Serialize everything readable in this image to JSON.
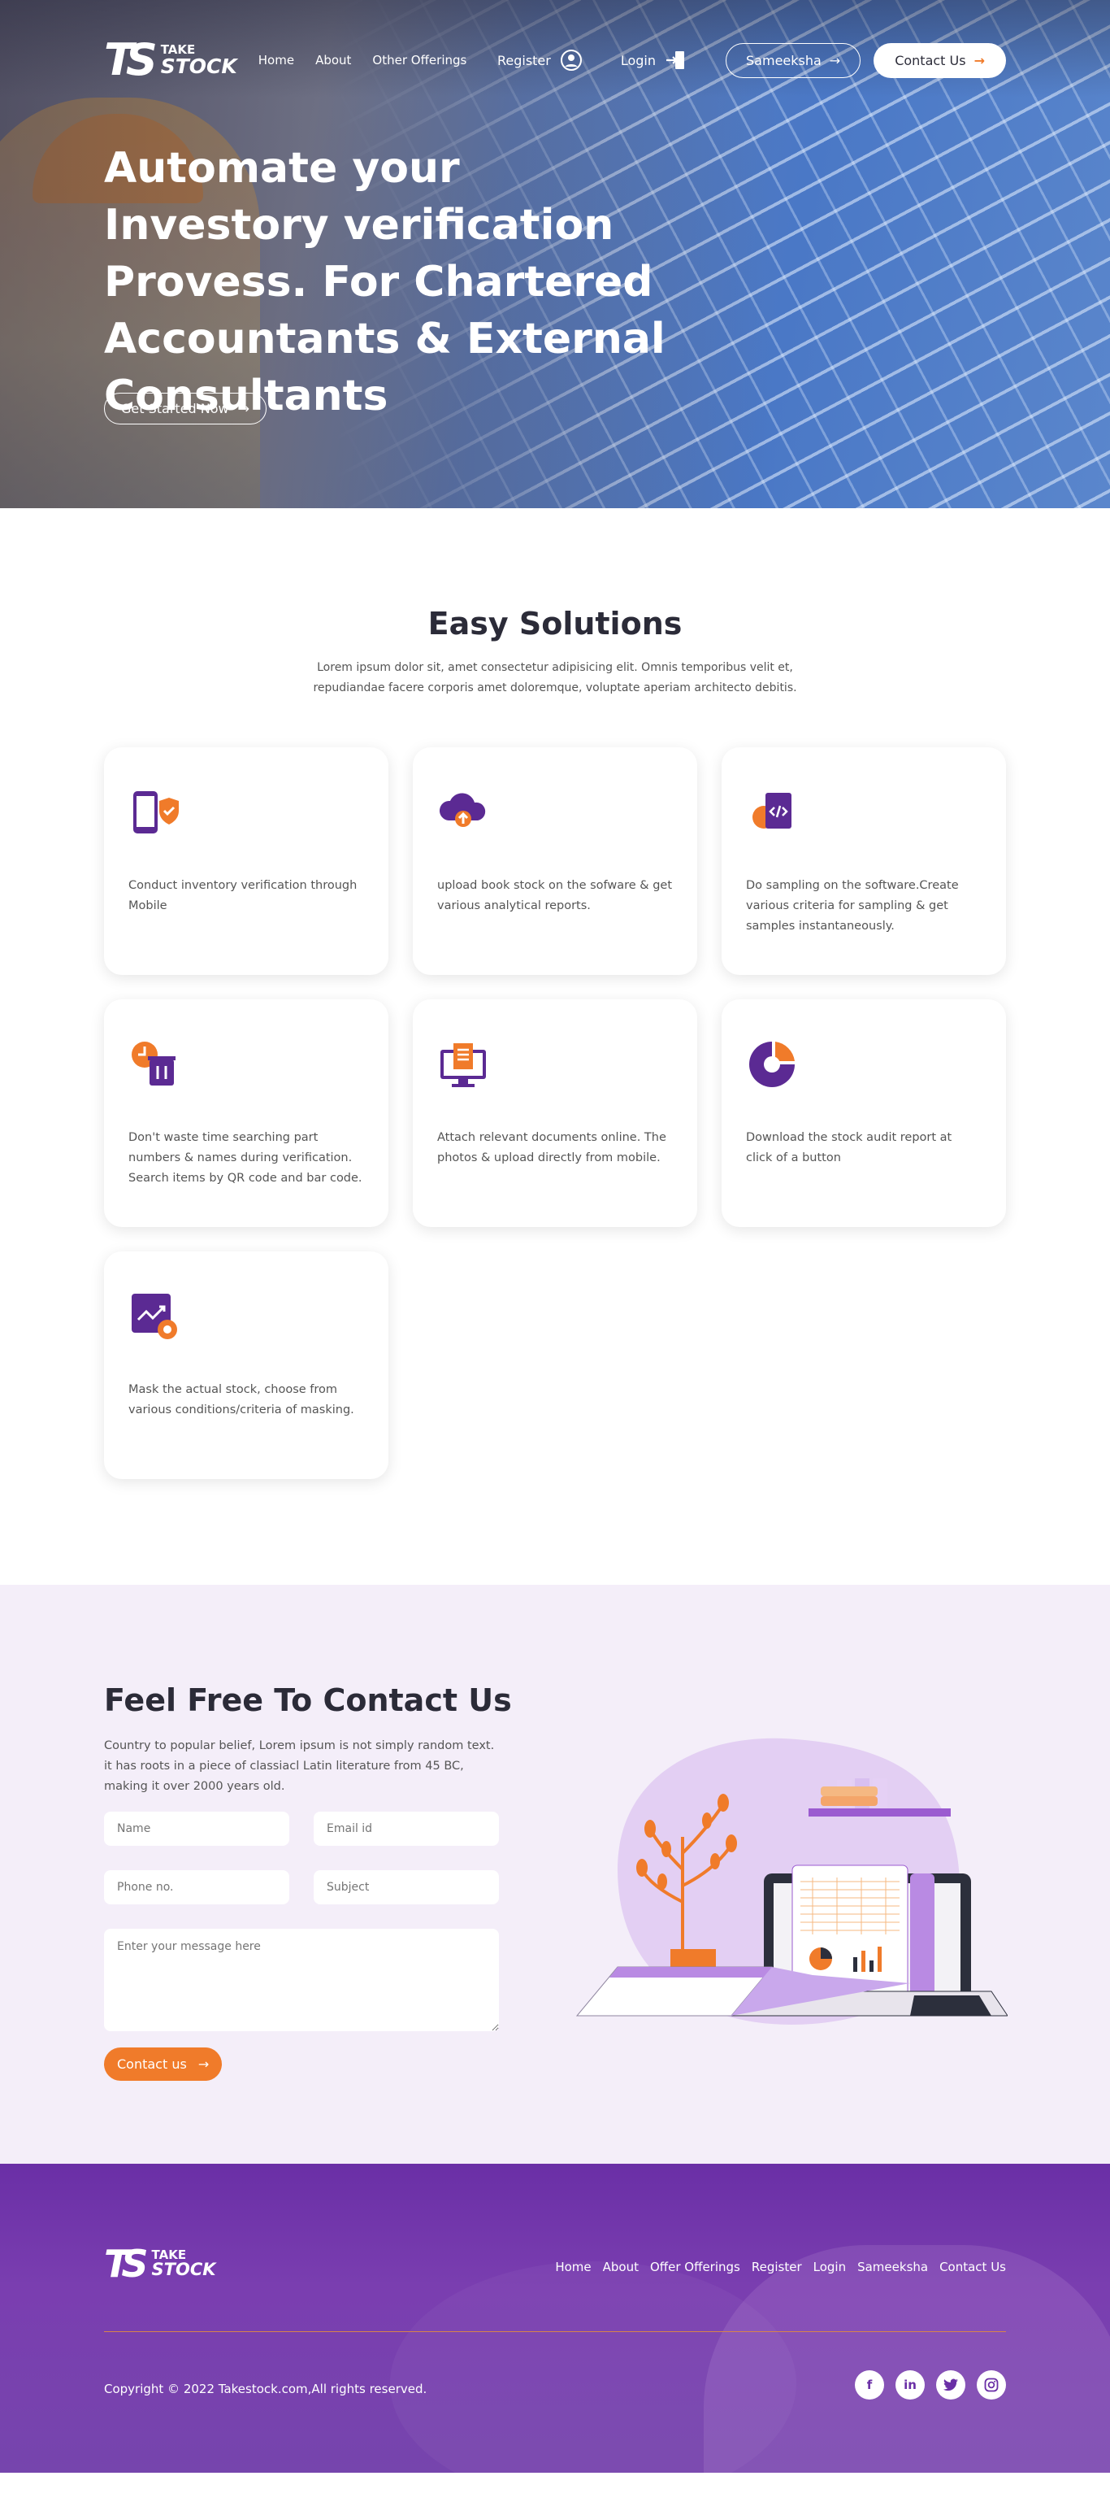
{
  "brand": {
    "mark": "TS",
    "word_top": "TAKE",
    "word_bottom": "STOCK"
  },
  "nav": {
    "links": [
      "Home",
      "About",
      "Other Offerings"
    ],
    "register": "Register",
    "login": "Login",
    "user_button": "Sameeksha",
    "contact_button": "Contact Us"
  },
  "hero": {
    "title": "Automate your Investory verification Provess. For Chartered Accountants & External Consultants",
    "cta": "Get Started Now"
  },
  "solutions": {
    "title": "Easy Solutions",
    "intro": "Lorem ipsum dolor sit, amet consectetur adipisicing elit. Omnis temporibus velit et, repudiandae facere corporis amet doloremque, voluptate aperiam architecto debitis.",
    "cards": [
      {
        "icon": "mobile-shield-icon",
        "text": "Conduct inventory verification through Mobile"
      },
      {
        "icon": "cloud-upload-icon",
        "text": "upload book stock on the sofware & get various analytical reports."
      },
      {
        "icon": "code-file-icon",
        "text": "Do sampling on the software.Create various criteria for sampling & get samples instantaneously."
      },
      {
        "icon": "delete-time-icon",
        "text": "Don't waste time searching part numbers & names during verification. Search items by QR code and bar code."
      },
      {
        "icon": "monitor-document-icon",
        "text": "Attach relevant documents online. The photos & upload directly from mobile."
      },
      {
        "icon": "pie-chart-icon",
        "text": "Download the stock audit report at click of a button"
      },
      {
        "icon": "analytics-settings-icon",
        "text": "Mask the actual stock, choose from various conditions/criteria of masking."
      }
    ]
  },
  "contact": {
    "title": "Feel Free To Contact Us",
    "desc": "Country to popular belief, Lorem ipsum is not simply random text. it has roots in a piece of classiacl Latin literature from 45 BC, making it over 2000 years old.",
    "placeholders": {
      "name": "Name",
      "email": "Email id",
      "phone": "Phone no.",
      "subject": "Subject",
      "message": "Enter your message here"
    },
    "submit": "Contact us"
  },
  "footer": {
    "links": [
      "Home",
      "About",
      "Offer Offerings",
      "Register",
      "Login",
      "Sameeksha",
      "Contact Us"
    ],
    "copyright": "Copyright © 2022 Takestock.com,All rights reserved.",
    "socials": [
      "facebook-icon",
      "linkedin-icon",
      "twitter-icon",
      "instagram-icon"
    ]
  },
  "colors": {
    "accent": "#f07b2a",
    "purple": "#6a2fa6",
    "contact_bg": "#f4eef9"
  }
}
